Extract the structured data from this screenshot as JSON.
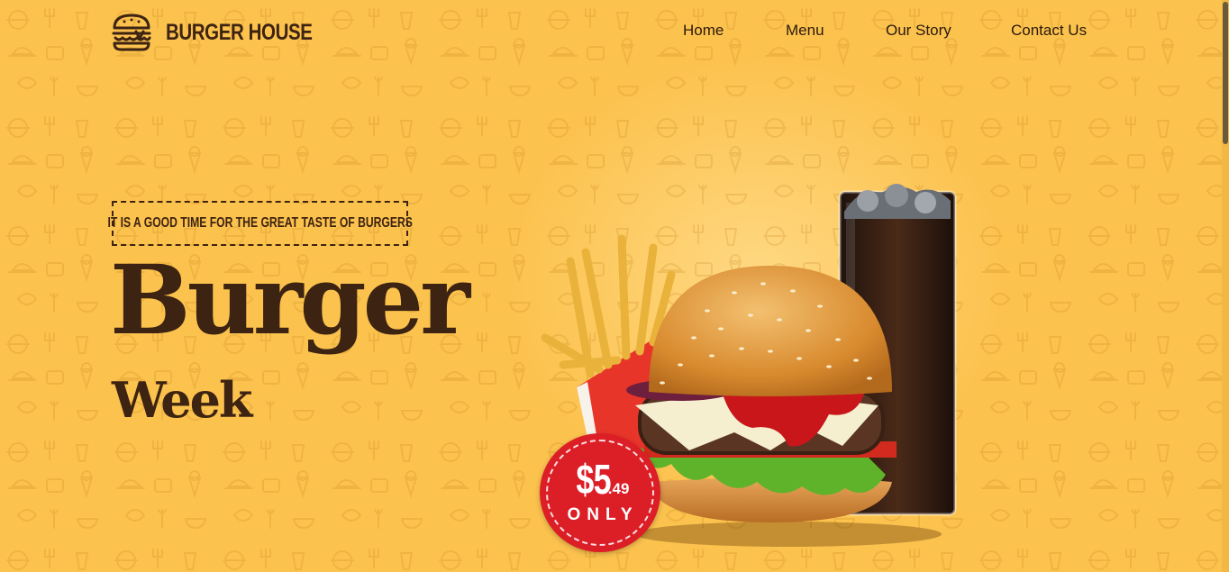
{
  "brand": {
    "name": "BURGER HOUSE",
    "logo_icon": "burger-icon"
  },
  "nav": {
    "items": [
      {
        "label": "Home"
      },
      {
        "label": "Menu"
      },
      {
        "label": "Our Story"
      },
      {
        "label": "Contact Us"
      }
    ]
  },
  "hero": {
    "tagline": "IT IS A GOOD TIME FOR THE GREAT TASTE OF BURGERS",
    "title_line1": "Burger",
    "title_line2": "Week",
    "price_main": "$5",
    "price_cents": ".49",
    "price_note": "ONLY"
  },
  "colors": {
    "background": "#fcc24e",
    "text_dark": "#3d2311",
    "badge_red": "#dc1e27"
  }
}
